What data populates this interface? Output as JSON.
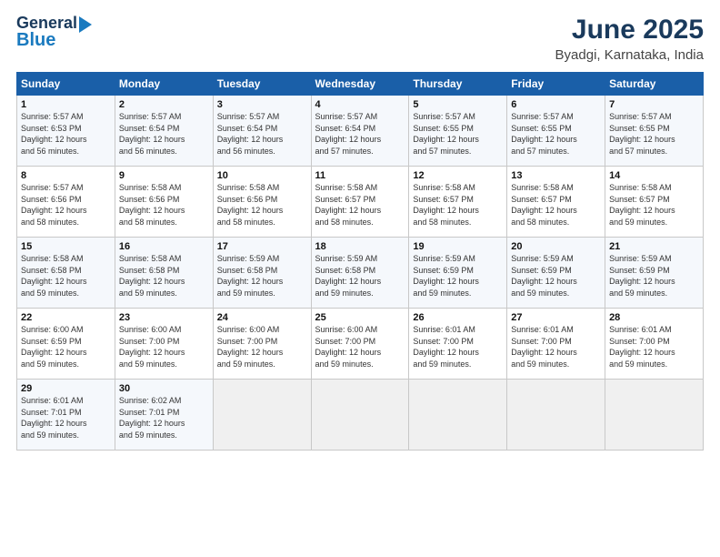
{
  "header": {
    "logo_line1": "General",
    "logo_line2": "Blue",
    "title": "June 2025",
    "subtitle": "Byadgi, Karnataka, India"
  },
  "weekdays": [
    "Sunday",
    "Monday",
    "Tuesday",
    "Wednesday",
    "Thursday",
    "Friday",
    "Saturday"
  ],
  "weeks": [
    [
      {
        "day": "1",
        "info": "Sunrise: 5:57 AM\nSunset: 6:53 PM\nDaylight: 12 hours\nand 56 minutes."
      },
      {
        "day": "2",
        "info": "Sunrise: 5:57 AM\nSunset: 6:54 PM\nDaylight: 12 hours\nand 56 minutes."
      },
      {
        "day": "3",
        "info": "Sunrise: 5:57 AM\nSunset: 6:54 PM\nDaylight: 12 hours\nand 56 minutes."
      },
      {
        "day": "4",
        "info": "Sunrise: 5:57 AM\nSunset: 6:54 PM\nDaylight: 12 hours\nand 57 minutes."
      },
      {
        "day": "5",
        "info": "Sunrise: 5:57 AM\nSunset: 6:55 PM\nDaylight: 12 hours\nand 57 minutes."
      },
      {
        "day": "6",
        "info": "Sunrise: 5:57 AM\nSunset: 6:55 PM\nDaylight: 12 hours\nand 57 minutes."
      },
      {
        "day": "7",
        "info": "Sunrise: 5:57 AM\nSunset: 6:55 PM\nDaylight: 12 hours\nand 57 minutes."
      }
    ],
    [
      {
        "day": "8",
        "info": "Sunrise: 5:57 AM\nSunset: 6:56 PM\nDaylight: 12 hours\nand 58 minutes."
      },
      {
        "day": "9",
        "info": "Sunrise: 5:58 AM\nSunset: 6:56 PM\nDaylight: 12 hours\nand 58 minutes."
      },
      {
        "day": "10",
        "info": "Sunrise: 5:58 AM\nSunset: 6:56 PM\nDaylight: 12 hours\nand 58 minutes."
      },
      {
        "day": "11",
        "info": "Sunrise: 5:58 AM\nSunset: 6:57 PM\nDaylight: 12 hours\nand 58 minutes."
      },
      {
        "day": "12",
        "info": "Sunrise: 5:58 AM\nSunset: 6:57 PM\nDaylight: 12 hours\nand 58 minutes."
      },
      {
        "day": "13",
        "info": "Sunrise: 5:58 AM\nSunset: 6:57 PM\nDaylight: 12 hours\nand 58 minutes."
      },
      {
        "day": "14",
        "info": "Sunrise: 5:58 AM\nSunset: 6:57 PM\nDaylight: 12 hours\nand 59 minutes."
      }
    ],
    [
      {
        "day": "15",
        "info": "Sunrise: 5:58 AM\nSunset: 6:58 PM\nDaylight: 12 hours\nand 59 minutes."
      },
      {
        "day": "16",
        "info": "Sunrise: 5:58 AM\nSunset: 6:58 PM\nDaylight: 12 hours\nand 59 minutes."
      },
      {
        "day": "17",
        "info": "Sunrise: 5:59 AM\nSunset: 6:58 PM\nDaylight: 12 hours\nand 59 minutes."
      },
      {
        "day": "18",
        "info": "Sunrise: 5:59 AM\nSunset: 6:58 PM\nDaylight: 12 hours\nand 59 minutes."
      },
      {
        "day": "19",
        "info": "Sunrise: 5:59 AM\nSunset: 6:59 PM\nDaylight: 12 hours\nand 59 minutes."
      },
      {
        "day": "20",
        "info": "Sunrise: 5:59 AM\nSunset: 6:59 PM\nDaylight: 12 hours\nand 59 minutes."
      },
      {
        "day": "21",
        "info": "Sunrise: 5:59 AM\nSunset: 6:59 PM\nDaylight: 12 hours\nand 59 minutes."
      }
    ],
    [
      {
        "day": "22",
        "info": "Sunrise: 6:00 AM\nSunset: 6:59 PM\nDaylight: 12 hours\nand 59 minutes."
      },
      {
        "day": "23",
        "info": "Sunrise: 6:00 AM\nSunset: 7:00 PM\nDaylight: 12 hours\nand 59 minutes."
      },
      {
        "day": "24",
        "info": "Sunrise: 6:00 AM\nSunset: 7:00 PM\nDaylight: 12 hours\nand 59 minutes."
      },
      {
        "day": "25",
        "info": "Sunrise: 6:00 AM\nSunset: 7:00 PM\nDaylight: 12 hours\nand 59 minutes."
      },
      {
        "day": "26",
        "info": "Sunrise: 6:01 AM\nSunset: 7:00 PM\nDaylight: 12 hours\nand 59 minutes."
      },
      {
        "day": "27",
        "info": "Sunrise: 6:01 AM\nSunset: 7:00 PM\nDaylight: 12 hours\nand 59 minutes."
      },
      {
        "day": "28",
        "info": "Sunrise: 6:01 AM\nSunset: 7:00 PM\nDaylight: 12 hours\nand 59 minutes."
      }
    ],
    [
      {
        "day": "29",
        "info": "Sunrise: 6:01 AM\nSunset: 7:01 PM\nDaylight: 12 hours\nand 59 minutes."
      },
      {
        "day": "30",
        "info": "Sunrise: 6:02 AM\nSunset: 7:01 PM\nDaylight: 12 hours\nand 59 minutes."
      },
      {
        "day": "",
        "info": ""
      },
      {
        "day": "",
        "info": ""
      },
      {
        "day": "",
        "info": ""
      },
      {
        "day": "",
        "info": ""
      },
      {
        "day": "",
        "info": ""
      }
    ]
  ]
}
